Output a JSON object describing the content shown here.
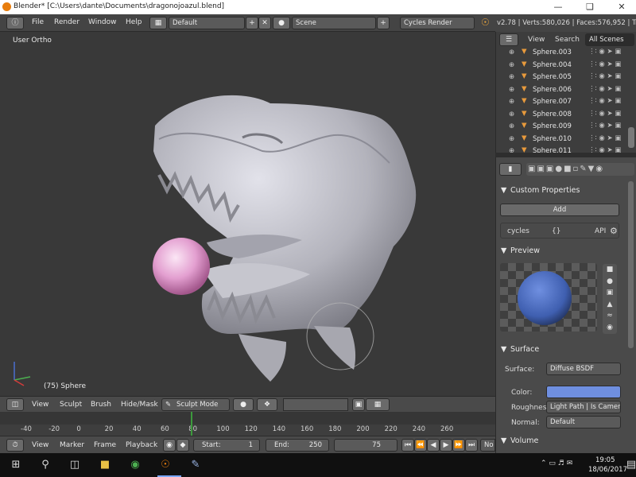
{
  "titlebar": {
    "title": "Blender* [C:\\Users\\dante\\Documents\\dragonojoazul.blend]"
  },
  "menu": {
    "items": [
      "File",
      "Render",
      "Window",
      "Help"
    ],
    "layout": "Default",
    "scene": "Scene",
    "engine": "Cycles Render",
    "stats": "v2.78 | Verts:580,026 | Faces:576,952 | Tris"
  },
  "viewport": {
    "view_label": "User Ortho",
    "object_label": "(75) Sphere"
  },
  "viewport_header": {
    "items": [
      "View",
      "Sculpt",
      "Brush",
      "Hide/Mask"
    ],
    "mode": "Sculpt Mode"
  },
  "timeline": {
    "ticks": [
      "-40",
      "-20",
      "0",
      "20",
      "40",
      "60",
      "80",
      "100",
      "120",
      "140",
      "160",
      "180",
      "200",
      "220",
      "240",
      "260"
    ],
    "current_frame": 75
  },
  "timeline_header": {
    "items": [
      "View",
      "Marker",
      "Frame",
      "Playback"
    ],
    "start_label": "Start:",
    "start_value": "1",
    "end_label": "End:",
    "end_value": "250",
    "frame_value": "75",
    "no_sync": "No"
  },
  "outliner": {
    "tabs": [
      "View",
      "Search",
      "All Scenes"
    ],
    "items": [
      "Sphere.003",
      "Sphere.004",
      "Sphere.005",
      "Sphere.006",
      "Sphere.007",
      "Sphere.008",
      "Sphere.009",
      "Sphere.010",
      "Sphere.011"
    ]
  },
  "properties": {
    "custom_properties": {
      "title": "Custom Properties",
      "add_label": "Add",
      "prop_name": "cycles",
      "prop_value": "{}",
      "prop_api": "API"
    },
    "preview": {
      "title": "Preview"
    },
    "surface": {
      "title": "Surface",
      "surface_label": "Surface:",
      "surface_value": "Diffuse BSDF",
      "color_label": "Color:",
      "roughness_label": "Roughnes",
      "roughness_value": "Light Path | Is Camer...",
      "normal_label": "Normal:",
      "normal_value": "Default"
    },
    "volume": {
      "title": "Volume"
    }
  },
  "taskbar": {
    "time": "19:05",
    "date": "18/06/2017"
  },
  "colors": {
    "accent": "#5680c2",
    "material": "#6f8fe0",
    "playhead": "#3c9a3c"
  }
}
